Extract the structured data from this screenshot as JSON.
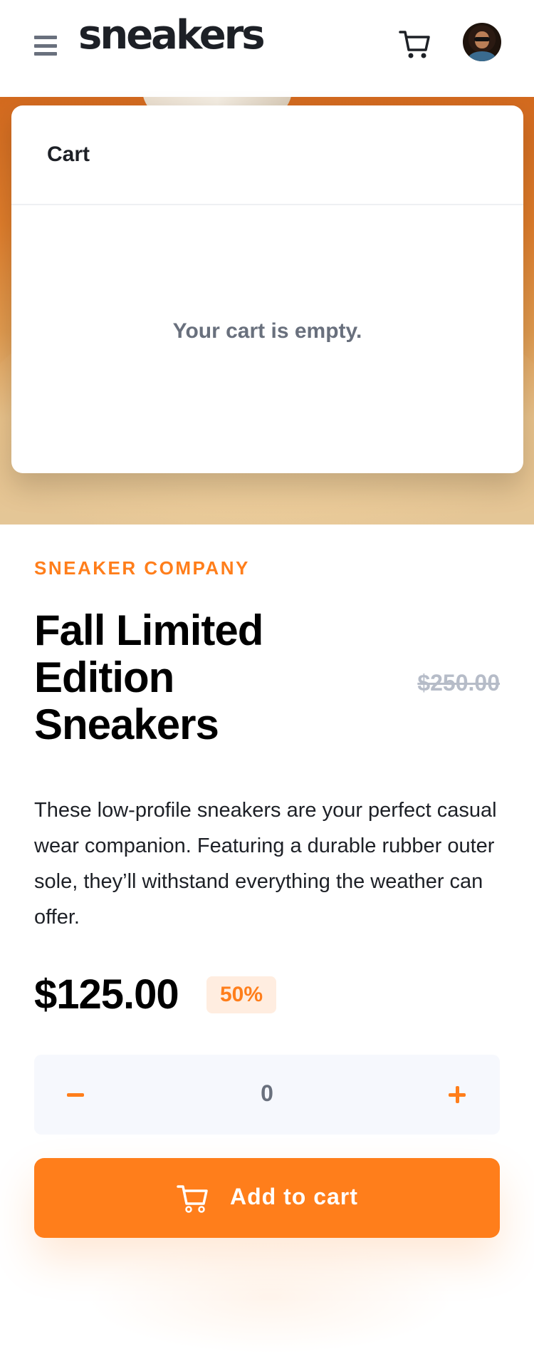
{
  "header": {
    "logo": "sneakers",
    "menu_icon": "hamburger-menu-icon",
    "cart_icon": "cart-icon",
    "avatar": "avatar"
  },
  "cart": {
    "title": "Cart",
    "empty_message": "Your cart is empty."
  },
  "product": {
    "brand": "SNEAKER COMPANY",
    "title": "Fall Limited Edition Sneakers",
    "description": "These low-profile sneakers are your perfect casual wear companion. Featuring a durable rubber outer sole, they’ll withstand everything the weather can offer.",
    "price": "$125.00",
    "discount": "50%",
    "original_price": "$250.00"
  },
  "quantity": {
    "value": "0",
    "minus_icon": "minus-icon",
    "plus_icon": "plus-icon"
  },
  "add_to_cart": {
    "label": "Add to cart",
    "icon": "cart-icon"
  },
  "colors": {
    "accent": "#ff7e1b",
    "accent_light": "#ffede0",
    "text_dark": "#1d2026",
    "text_muted": "#69707d",
    "text_light": "#b6bcc8",
    "qty_bg": "#f6f8fd"
  }
}
